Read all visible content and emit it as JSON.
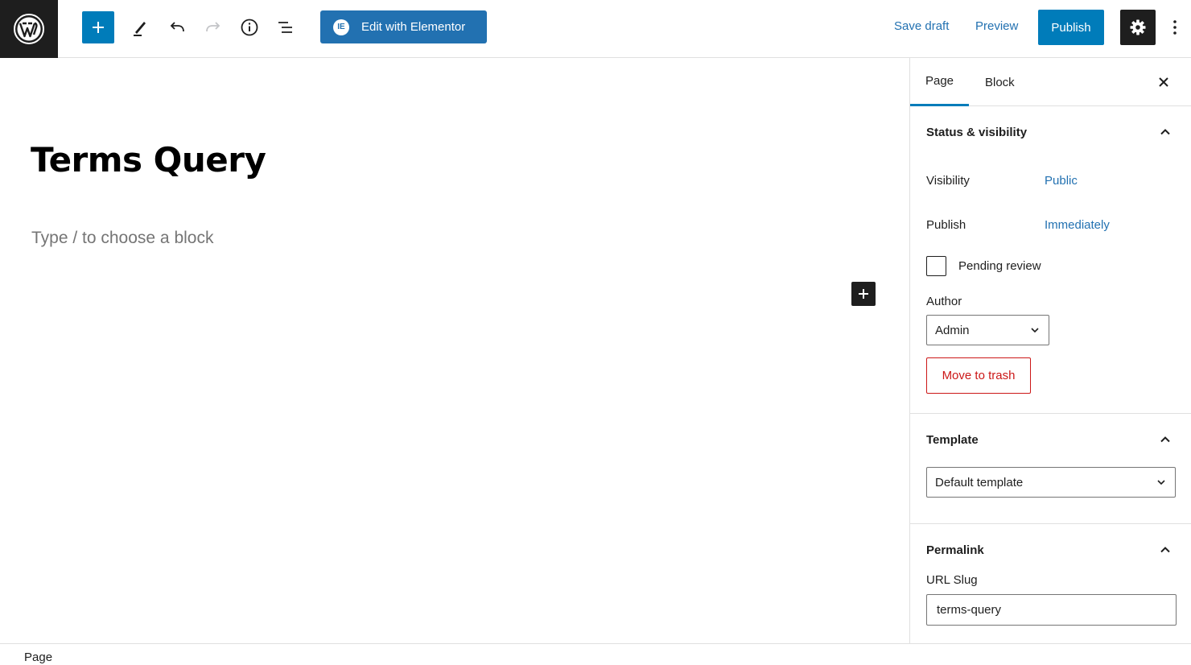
{
  "toolbar": {
    "elementor_label": "Edit with Elementor",
    "elementor_badge": "IE",
    "save_draft_label": "Save draft",
    "preview_label": "Preview",
    "publish_label": "Publish"
  },
  "editor": {
    "title": "Terms Query",
    "placeholder": "Type / to choose a block"
  },
  "sidebar": {
    "tabs": [
      {
        "label": "Page",
        "active": true
      },
      {
        "label": "Block",
        "active": false
      }
    ],
    "status": {
      "heading": "Status & visibility",
      "visibility_label": "Visibility",
      "visibility_value": "Public",
      "publish_label": "Publish",
      "publish_value": "Immediately",
      "pending_label": "Pending review",
      "author_label": "Author",
      "author_value": "Admin",
      "trash_label": "Move to trash"
    },
    "template": {
      "heading": "Template",
      "value": "Default template"
    },
    "permalink": {
      "heading": "Permalink",
      "slug_label": "URL Slug",
      "slug_value": "terms-query"
    }
  },
  "footer": {
    "breadcrumb": "Page"
  },
  "colors": {
    "accent": "#007cba",
    "link": "#2271b1",
    "dark": "#1e1e1e",
    "danger": "#cc1818"
  }
}
